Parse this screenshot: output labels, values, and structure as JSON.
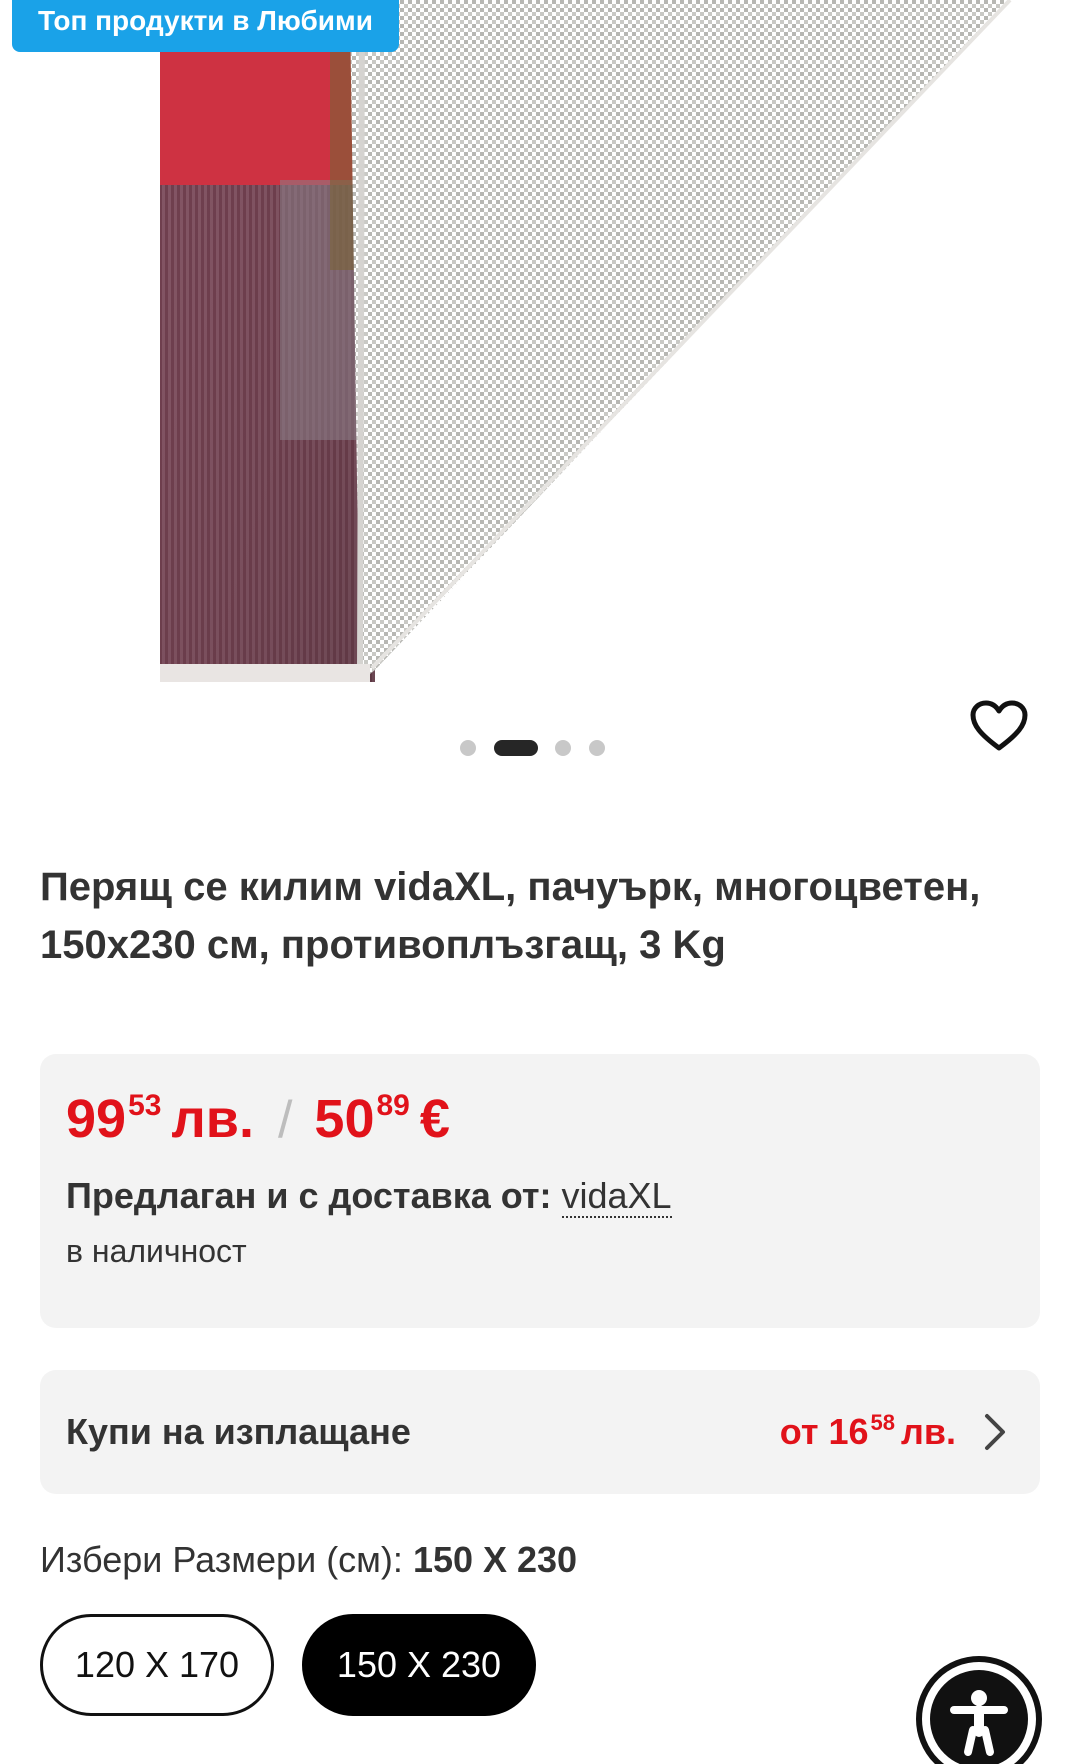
{
  "gallery": {
    "badge": "Топ продукти в Любими",
    "image_icon": "rug-image",
    "favorite_icon": "heart-outline-icon",
    "slide_count": 4,
    "active_slide": 2
  },
  "product": {
    "title": "Перящ се килим vidaXL, пачуърк, многоцветен, 150x230 см, противоплъзгащ, 3 Kg"
  },
  "price": {
    "bgn_main": "99",
    "bgn_sup": "53",
    "bgn_currency": "лв.",
    "separator": "/",
    "eur_main": "50",
    "eur_sup": "89",
    "eur_currency": "€",
    "seller_prefix": "Предлаган и с доставка от:",
    "seller_name": "vidaXL",
    "stock_status": "в наличност",
    "accent_color": "#e1121a"
  },
  "installment": {
    "label": "Купи на изплащане",
    "price_prefix": "от 16",
    "price_sup": "58",
    "price_currency": "лв.",
    "chevron_icon": "chevron-right-icon"
  },
  "size": {
    "label": "Избери Размери (см):",
    "selected_value": "150 X 230",
    "options": [
      {
        "label": "120 X 170",
        "selected": false
      },
      {
        "label": "150 X 230",
        "selected": true
      }
    ]
  },
  "accessibility": {
    "icon": "accessibility-icon"
  }
}
